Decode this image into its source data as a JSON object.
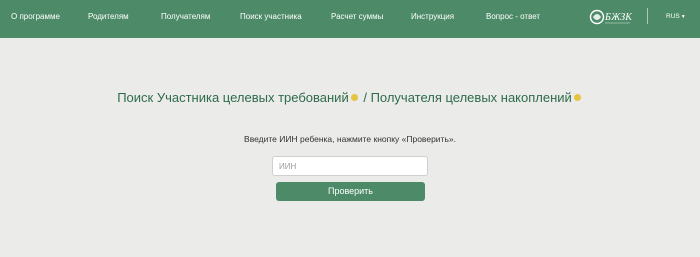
{
  "nav": {
    "items": [
      {
        "label": "О программе"
      },
      {
        "label": "Родителям"
      },
      {
        "label": "Получателям"
      },
      {
        "label": "Поиск участника"
      },
      {
        "label": "Расчет суммы"
      },
      {
        "label": "Инструкция"
      },
      {
        "label": "Вопрос - ответ"
      }
    ],
    "logo_text": "БЖЗК",
    "logo_icon": "bzhzk-logo",
    "lang": "RUS",
    "lang_icon": "chevron-down-icon"
  },
  "main": {
    "title_part1": "Поиск Участника целевых требований",
    "title_separator": " / ",
    "title_part2": "Получателя целевых накоплений",
    "instruction": "Введите ИИН ребенка, нажмите кнопку «Проверить».",
    "iin_placeholder": "ИИН",
    "iin_value": "",
    "check_button": "Проверить"
  },
  "colors": {
    "header_bg": "#4d8b68",
    "title_text": "#2f6b4b",
    "accent_dot": "#e6c443",
    "page_bg": "#ebebe9"
  }
}
